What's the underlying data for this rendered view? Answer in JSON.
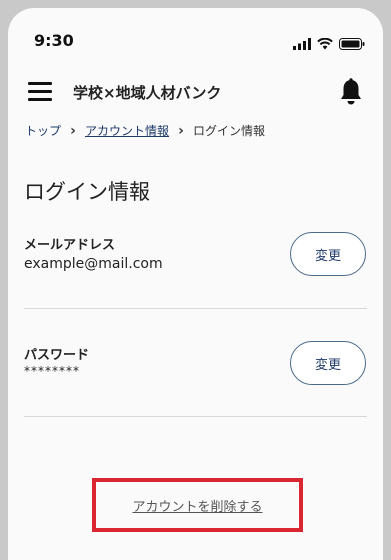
{
  "status_bar": {
    "time": "9:30"
  },
  "header": {
    "title": "学校×地域人材バンク"
  },
  "breadcrumb": [
    {
      "label": "トップ"
    },
    {
      "label": "アカウント情報"
    },
    {
      "label": "ログイン情報"
    }
  ],
  "page": {
    "title": "ログイン情報"
  },
  "email": {
    "label": "メールアドレス",
    "value": "example@mail.com",
    "button": "変更"
  },
  "password": {
    "label": "パスワード",
    "value": "********",
    "button": "変更"
  },
  "delete_account": {
    "label": "アカウントを削除する"
  },
  "colors": {
    "accent": "#1f3a6b",
    "highlight": "#d92630"
  }
}
